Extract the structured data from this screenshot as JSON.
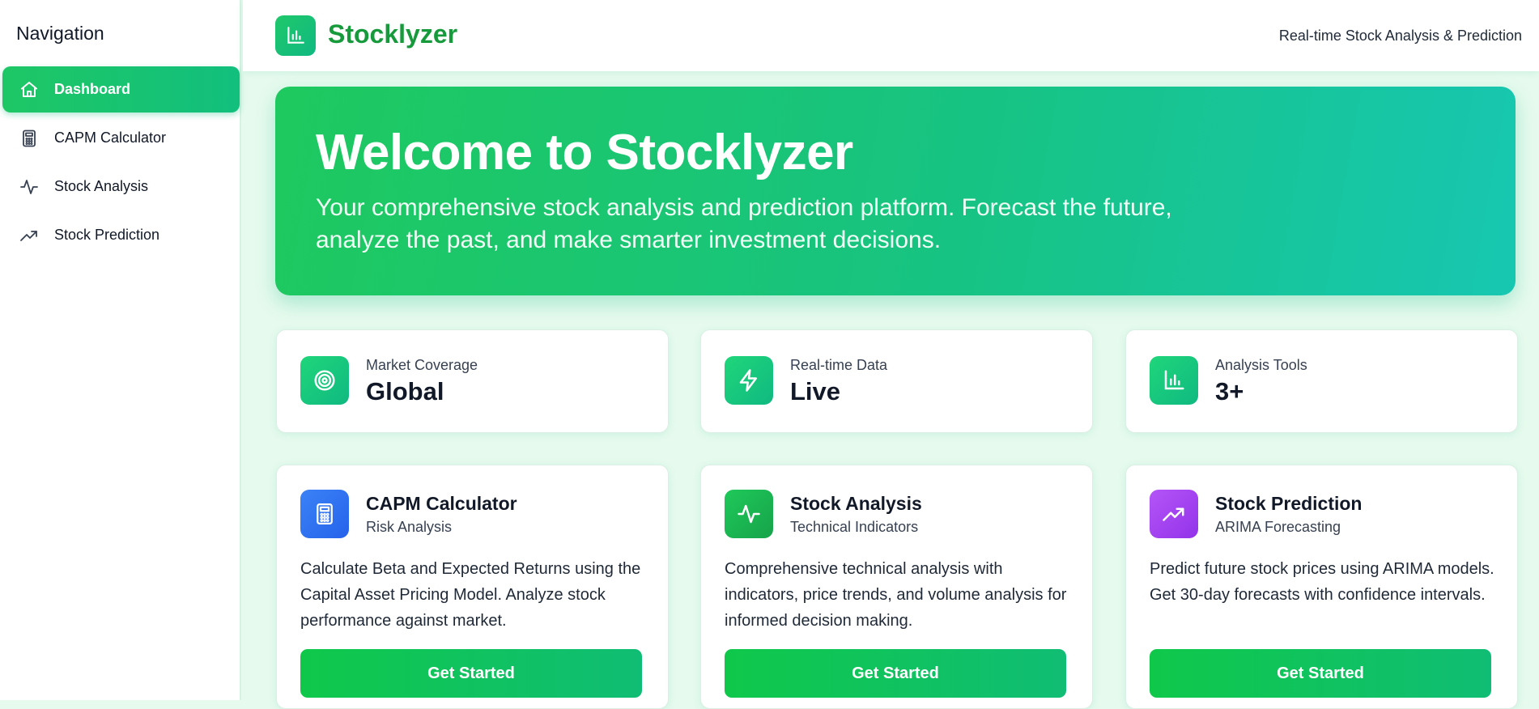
{
  "sidebar": {
    "title": "Navigation",
    "items": [
      {
        "label": "Dashboard",
        "icon": "home-icon",
        "active": true
      },
      {
        "label": "CAPM Calculator",
        "icon": "calculator-icon",
        "active": false
      },
      {
        "label": "Stock Analysis",
        "icon": "activity-icon",
        "active": false
      },
      {
        "label": "Stock Prediction",
        "icon": "trending-up-icon",
        "active": false
      }
    ]
  },
  "header": {
    "app_name": "Stocklyzer",
    "tagline": "Real-time Stock Analysis & Prediction",
    "logo_icon": "bar-chart-icon"
  },
  "hero": {
    "title": "Welcome to Stocklyzer",
    "subtitle": "Your comprehensive stock analysis and prediction platform. Forecast the future, analyze the past, and make smarter investment decisions."
  },
  "stats": [
    {
      "label": "Market Coverage",
      "value": "Global",
      "icon": "target-icon"
    },
    {
      "label": "Real-time Data",
      "value": "Live",
      "icon": "lightning-icon"
    },
    {
      "label": "Analysis Tools",
      "value": "3+",
      "icon": "bar-chart-icon"
    }
  ],
  "features": [
    {
      "title": "CAPM Calculator",
      "subtitle": "Risk Analysis",
      "description": "Calculate Beta and Expected Returns using the Capital Asset Pricing Model. Analyze stock performance against market.",
      "button": "Get Started",
      "icon": "calculator-icon",
      "color": "#3b82f6"
    },
    {
      "title": "Stock Analysis",
      "subtitle": "Technical Indicators",
      "description": "Comprehensive technical analysis with indicators, price trends, and volume analysis for informed decision making.",
      "button": "Get Started",
      "icon": "activity-icon",
      "color": "#16c34a"
    },
    {
      "title": "Stock Prediction",
      "subtitle": "ARIMA Forecasting",
      "description": "Predict future stock prices using ARIMA models. Get 30-day forecasts with confidence intervals.",
      "button": "Get Started",
      "icon": "trending-up-icon",
      "color": "#a855f7"
    }
  ],
  "colors": {
    "brand_green": "#169a3c",
    "accent": "#10b981"
  }
}
